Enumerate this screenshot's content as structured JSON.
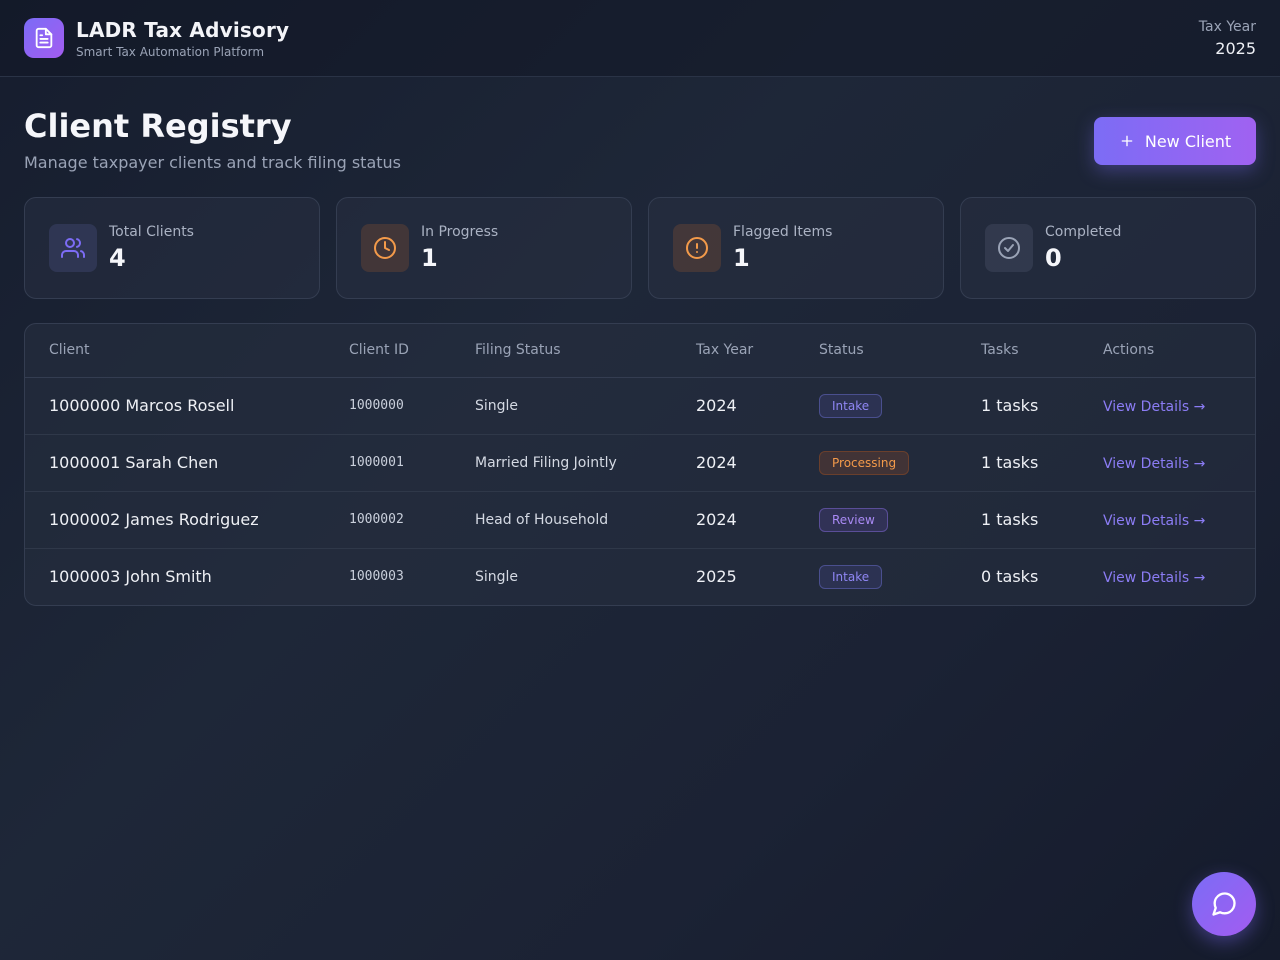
{
  "header": {
    "title": "LADR Tax Advisory",
    "subtitle": "Smart Tax Automation Platform",
    "tax_year_label": "Tax Year",
    "tax_year_value": "2025"
  },
  "page": {
    "title": "Client Registry",
    "subtitle": "Manage taxpayer clients and track filing status",
    "new_client_label": "New Client"
  },
  "stats": [
    {
      "label": "Total Clients",
      "value": "4",
      "icon": "users-icon",
      "color": "#7c6cf5"
    },
    {
      "label": "In Progress",
      "value": "1",
      "icon": "clock-icon",
      "color": "#f39a4a"
    },
    {
      "label": "Flagged Items",
      "value": "1",
      "icon": "alert-circle-icon",
      "color": "#f39a4a"
    },
    {
      "label": "Completed",
      "value": "0",
      "icon": "check-circle-icon",
      "color": "#9aa3b6"
    }
  ],
  "table": {
    "headers": [
      "Client",
      "Client ID",
      "Filing Status",
      "Tax Year",
      "Status",
      "Tasks",
      "Actions"
    ],
    "rows": [
      {
        "client": "1000000 Marcos Rosell",
        "id": "1000000",
        "filing": "Single",
        "year": "2024",
        "status": "Intake",
        "tasks": "1 tasks",
        "action": "View Details →"
      },
      {
        "client": "1000001 Sarah Chen",
        "id": "1000001",
        "filing": "Married Filing Jointly",
        "year": "2024",
        "status": "Processing",
        "tasks": "1 tasks",
        "action": "View Details →"
      },
      {
        "client": "1000002 James Rodriguez",
        "id": "1000002",
        "filing": "Head of Household",
        "year": "2024",
        "status": "Review",
        "tasks": "1 tasks",
        "action": "View Details →"
      },
      {
        "client": "1000003 John Smith",
        "id": "1000003",
        "filing": "Single",
        "year": "2025",
        "status": "Intake",
        "tasks": "0 tasks",
        "action": "View Details →"
      }
    ]
  },
  "colors": {
    "accent": "#7c6cf5",
    "warning": "#f39a4a"
  }
}
